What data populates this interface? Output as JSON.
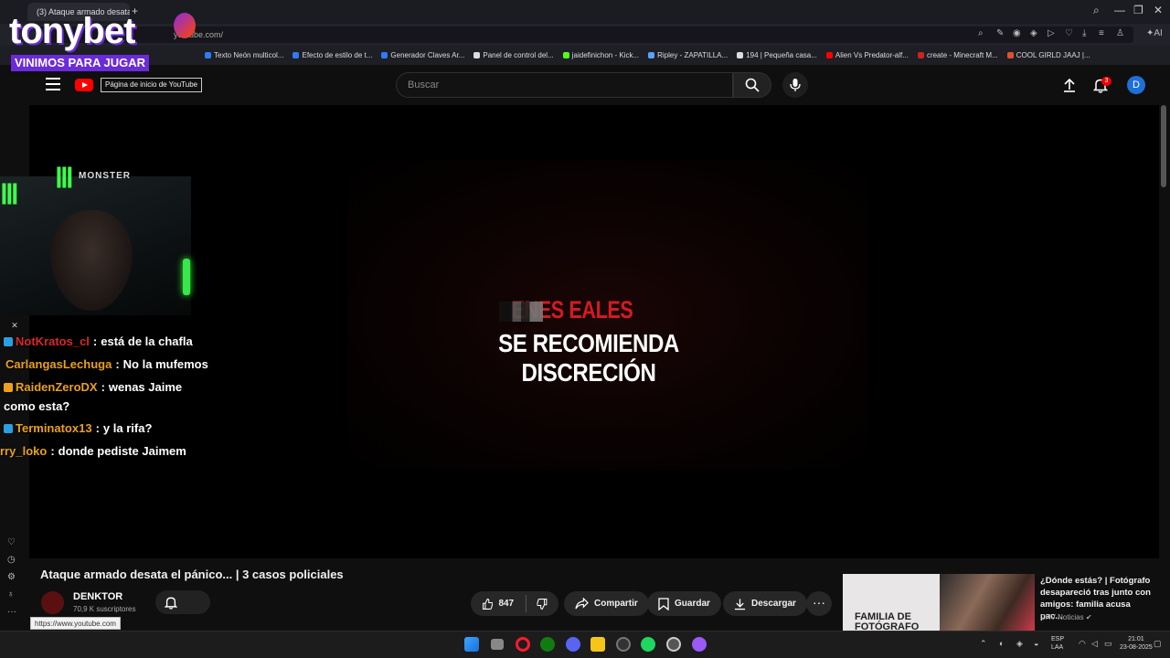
{
  "browser": {
    "tab_title": "(3) Ataque armado desata...",
    "new_tab": "+",
    "url": "youtube.com/",
    "ai_label": "AI",
    "bookmarks": [
      "Texto Neón multicol...",
      "Efecto de estilo de t...",
      "Generador Claves Ar...",
      "Panel de control del...",
      "jaidefinichon - Kick...",
      "Ripley - ZAPATILLA...",
      "194 | Pequeña casa...",
      "Alien Vs Predator-alf...",
      "create - Minecraft M...",
      "COOL GIRLD JAAJ |..."
    ],
    "bookmark_colors": [
      "#2d7cf6",
      "#2d7cf6",
      "#2d7cf6",
      "#dddddd",
      "#53fc18",
      "#5aa0ff",
      "#dddddd",
      "#ff0000",
      "#cc2222",
      "#e05030",
      "#aaaaaa"
    ]
  },
  "youtube": {
    "logo_tooltip": "Página de inicio de YouTube",
    "search_placeholder": "Buscar",
    "notif_count": "3",
    "avatar_letter": "D"
  },
  "player": {
    "warning_line1": "ENES   EALES",
    "warning_line2": "SE RECOMIENDA DISCRECIÓN"
  },
  "overlay": {
    "brand": "tonybet",
    "slogan": "VINIMOS PARA JUGAR",
    "sponsor": "MONSTER",
    "chat": [
      {
        "user": "NotKratos_cl",
        "sep": ":",
        "msg": "está de la chafla",
        "color": "#d9262d",
        "badge": "#2aa0e0"
      },
      {
        "user": "CarlangasLechuga",
        "sep": ":",
        "msg": "No la mufemos",
        "color": "#e8a020",
        "badge": ""
      },
      {
        "user": "RaidenZeroDX",
        "sep": ":",
        "msg": "wenas Jaime",
        "msg2": "como esta?",
        "color": "#e8a020",
        "badge": "#f0a020"
      },
      {
        "user": "Terminatox13",
        "sep": ":",
        "msg": "y la rifa?",
        "color": "#e8a020",
        "badge": "#2aa0e0"
      },
      {
        "user": "rry_loko",
        "sep": ":",
        "msg": "donde pediste Jaimem",
        "color": "#e8a020",
        "badge": ""
      }
    ]
  },
  "video": {
    "title": "Ataque armado desata el pánico... | 3 casos policiales",
    "channel": "DENKTOR",
    "subscribers": "70,9 K suscriptores",
    "likes": "847",
    "share": "Compartir",
    "save": "Guardar",
    "download": "Descargar",
    "more": "···"
  },
  "recommended": {
    "title": "¿Dónde estás? | Fotógrafo desapareció tras junto con amigos: familia acusa pac...",
    "channel": "CHV Noticias",
    "thumb_text": "FAMILIA DE FOTÓGRAFO"
  },
  "status_url": "https://www.youtube.com",
  "taskbar": {
    "lang": "ESP",
    "layout": "LAA",
    "time": "21:01",
    "date": "23-08-2025"
  }
}
